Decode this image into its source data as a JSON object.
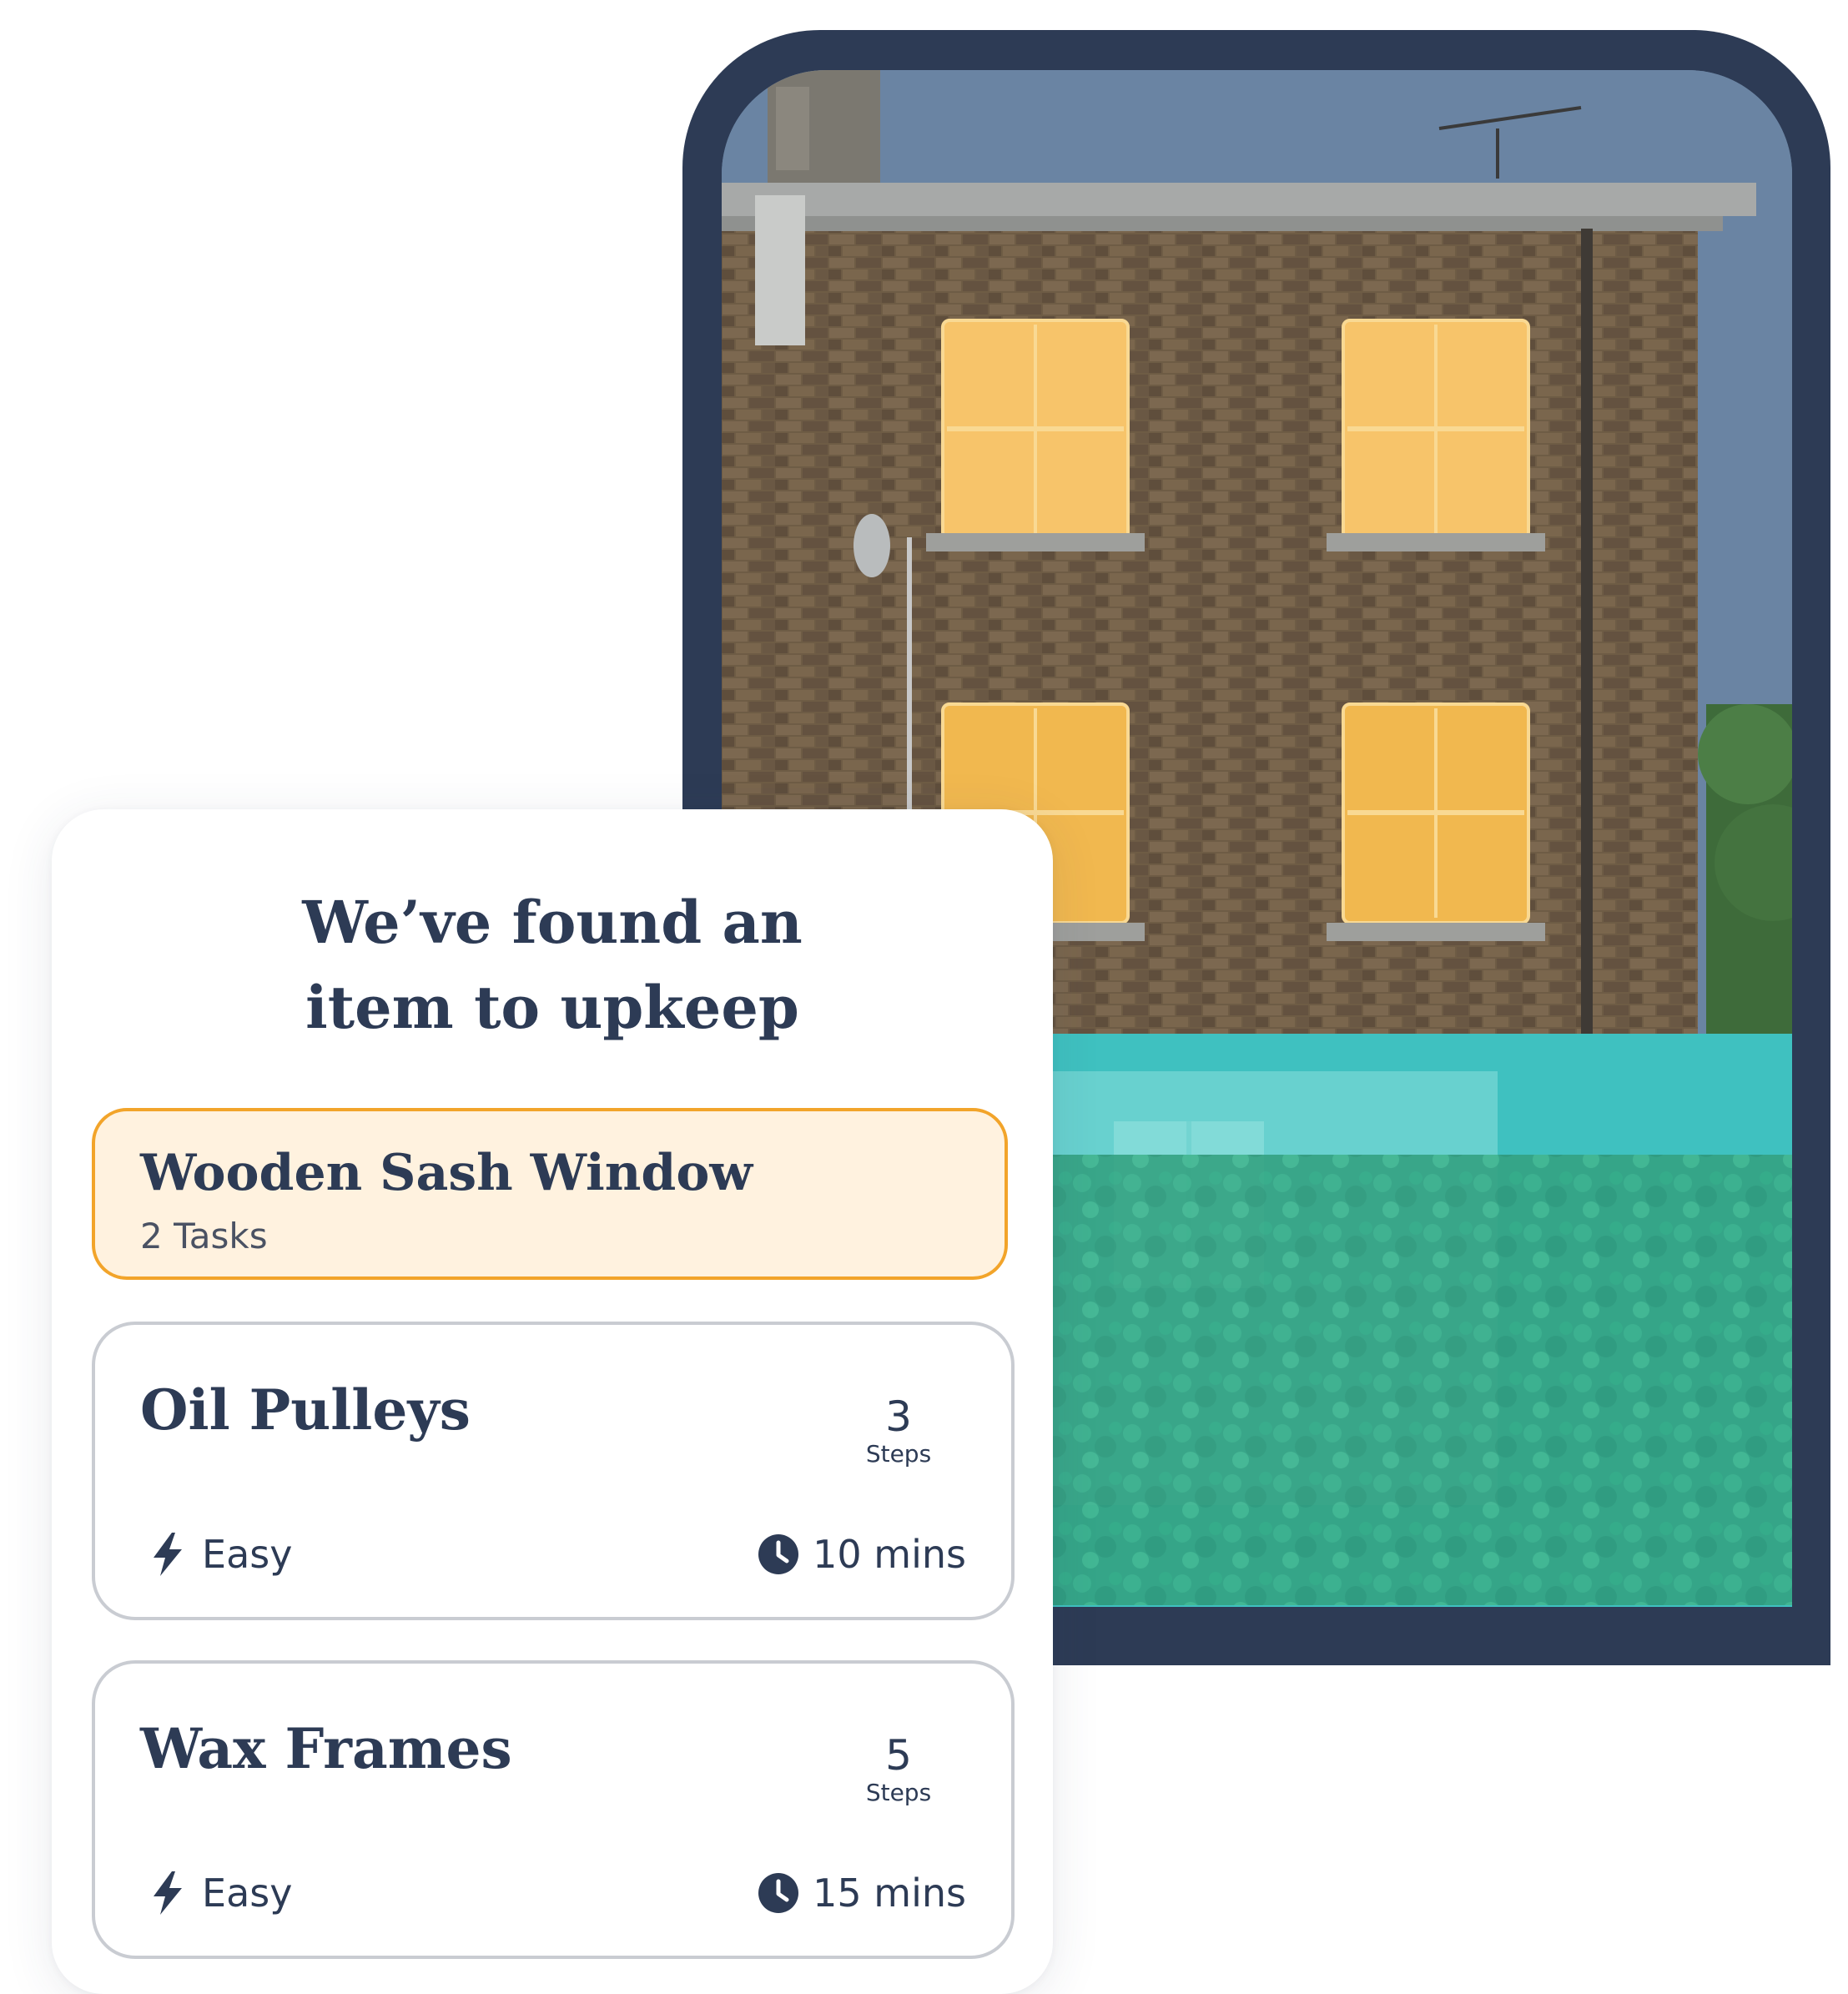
{
  "colors": {
    "navy": "#2d3b55",
    "accent_orange": "#f2a42a",
    "highlight_bg": "#fff2df",
    "window_highlight": "#f7c46a",
    "teal_overlay": "#3ec7c5"
  },
  "photo": {
    "description_icon": "house-photo"
  },
  "card": {
    "title_line1": "We’ve found an",
    "title_line2": "item to upkeep",
    "item": {
      "name": "Wooden Sash Window",
      "count": "2 Tasks"
    },
    "tasks": [
      {
        "name": "Oil Pulleys",
        "steps": "3",
        "steps_label": "Steps",
        "difficulty": "Easy",
        "duration": "10 mins",
        "difficulty_icon": "lightning-icon",
        "duration_icon": "clock-icon"
      },
      {
        "name": "Wax Frames",
        "steps": "5",
        "steps_label": "Steps",
        "difficulty": "Easy",
        "duration": "15 mins",
        "difficulty_icon": "lightning-icon",
        "duration_icon": "clock-icon"
      }
    ]
  }
}
